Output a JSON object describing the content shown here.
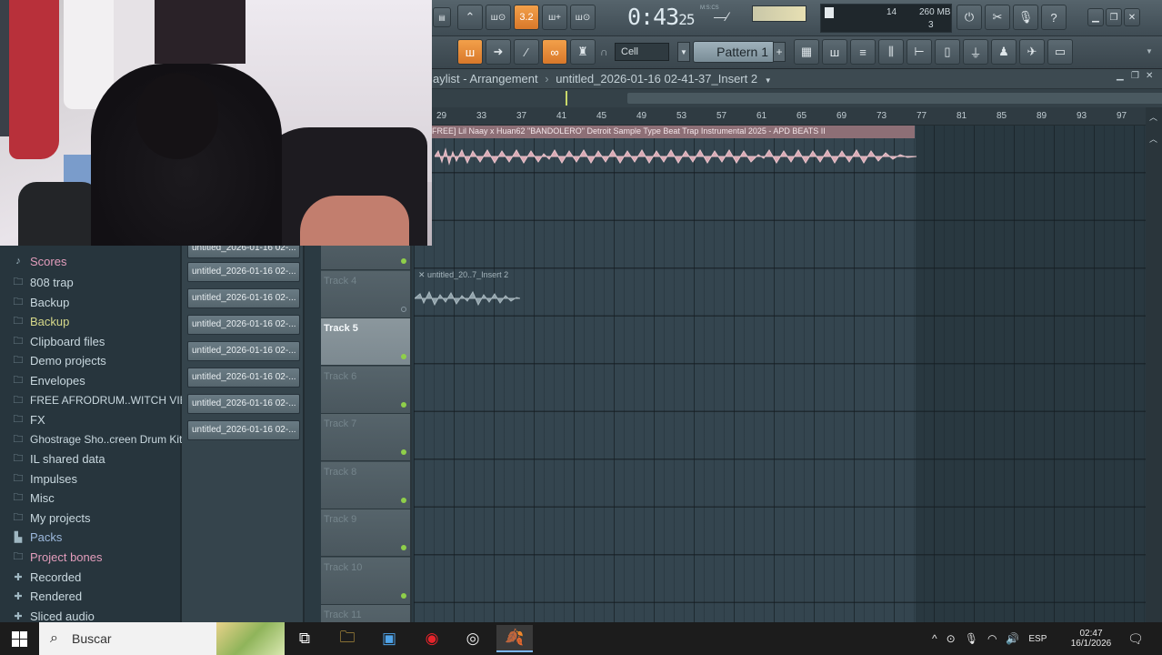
{
  "toolbar": {
    "time_display": "0:43",
    "time_sub": "25",
    "time_unit": "M:S:CS",
    "tempo_value": "3.2",
    "cpu_value": "14",
    "memory": "260 MB",
    "polyphony": "3",
    "snap_label": "Cell",
    "pattern_label": "Pattern 1",
    "pattern_plus": "+"
  },
  "browser": {
    "items": [
      {
        "label": "Scores",
        "icon": "music-note-icon",
        "style": "pink"
      },
      {
        "label": "808 trap",
        "icon": "folder-icon",
        "style": "normal"
      },
      {
        "label": "Backup",
        "icon": "folder-icon",
        "style": "normal"
      },
      {
        "label": "Backup",
        "icon": "folder-icon",
        "style": "yellow"
      },
      {
        "label": "Clipboard files",
        "icon": "folder-icon",
        "style": "normal"
      },
      {
        "label": "Demo projects",
        "icon": "folder-icon",
        "style": "normal"
      },
      {
        "label": "Envelopes",
        "icon": "folder-icon",
        "style": "normal"
      },
      {
        "label": "FREE AFRODRUM..WITCH VIBEZ",
        "icon": "folder-icon",
        "style": "normal"
      },
      {
        "label": "FX",
        "icon": "folder-icon",
        "style": "normal"
      },
      {
        "label": "Ghostrage Sho..creen Drum Kit",
        "icon": "folder-icon",
        "style": "normal"
      },
      {
        "label": "IL shared data",
        "icon": "folder-icon",
        "style": "normal"
      },
      {
        "label": "Impulses",
        "icon": "folder-icon",
        "style": "normal"
      },
      {
        "label": "Misc",
        "icon": "folder-icon",
        "style": "normal"
      },
      {
        "label": "My projects",
        "icon": "folder-icon",
        "style": "normal"
      },
      {
        "label": "Packs",
        "icon": "packs-icon",
        "style": "blue"
      },
      {
        "label": "Project bones",
        "icon": "folder-icon",
        "style": "pink"
      },
      {
        "label": "Recorded",
        "icon": "plus-icon",
        "style": "normal"
      },
      {
        "label": "Rendered",
        "icon": "plus-icon",
        "style": "normal"
      },
      {
        "label": "Sliced audio",
        "icon": "plus-icon",
        "style": "normal"
      }
    ]
  },
  "picker": {
    "clips": [
      "untitled_2026-01-16 02-...",
      "untitled_2026-01-16 02-...",
      "untitled_2026-01-16 02-...",
      "untitled_2026-01-16 02-...",
      "untitled_2026-01-16 02-...",
      "untitled_2026-01-16 02-...",
      "untitled_2026-01-16 02-...",
      "untitled_2026-01-16 02-..."
    ]
  },
  "playlist": {
    "title": "aylist - Arrangement",
    "title_sep": "›",
    "title_file": "untitled_2026-01-16 02-41-37_Insert 2",
    "ruler": [
      "29",
      "33",
      "37",
      "41",
      "45",
      "49",
      "53",
      "57",
      "61",
      "65",
      "69",
      "73",
      "77",
      "81",
      "85",
      "89",
      "93",
      "97"
    ],
    "main_clip": "FREE] Lil Naay x Huan62 \"BANDOLERO\" Detroit Sample Type Beat  Trap Instrumental 2025 - APD BEATS II",
    "small_clip": "untitled_20..7_Insert 2",
    "tracks": [
      {
        "name": "",
        "active": false,
        "dot": "green"
      },
      {
        "name": "Track 4",
        "active": false,
        "dot": "ring"
      },
      {
        "name": "Track 5",
        "active": true,
        "dot": "green"
      },
      {
        "name": "Track 6",
        "active": false,
        "dot": "green"
      },
      {
        "name": "Track 7",
        "active": false,
        "dot": "green"
      },
      {
        "name": "Track 8",
        "active": false,
        "dot": "green"
      },
      {
        "name": "Track 9",
        "active": false,
        "dot": "green"
      },
      {
        "name": "Track 10",
        "active": false,
        "dot": "green"
      },
      {
        "name": "Track 11",
        "active": false,
        "dot": "green"
      }
    ]
  },
  "taskbar": {
    "search_placeholder": "Buscar",
    "language": "ESP",
    "time": "02:47",
    "date": "16/1/2026"
  }
}
